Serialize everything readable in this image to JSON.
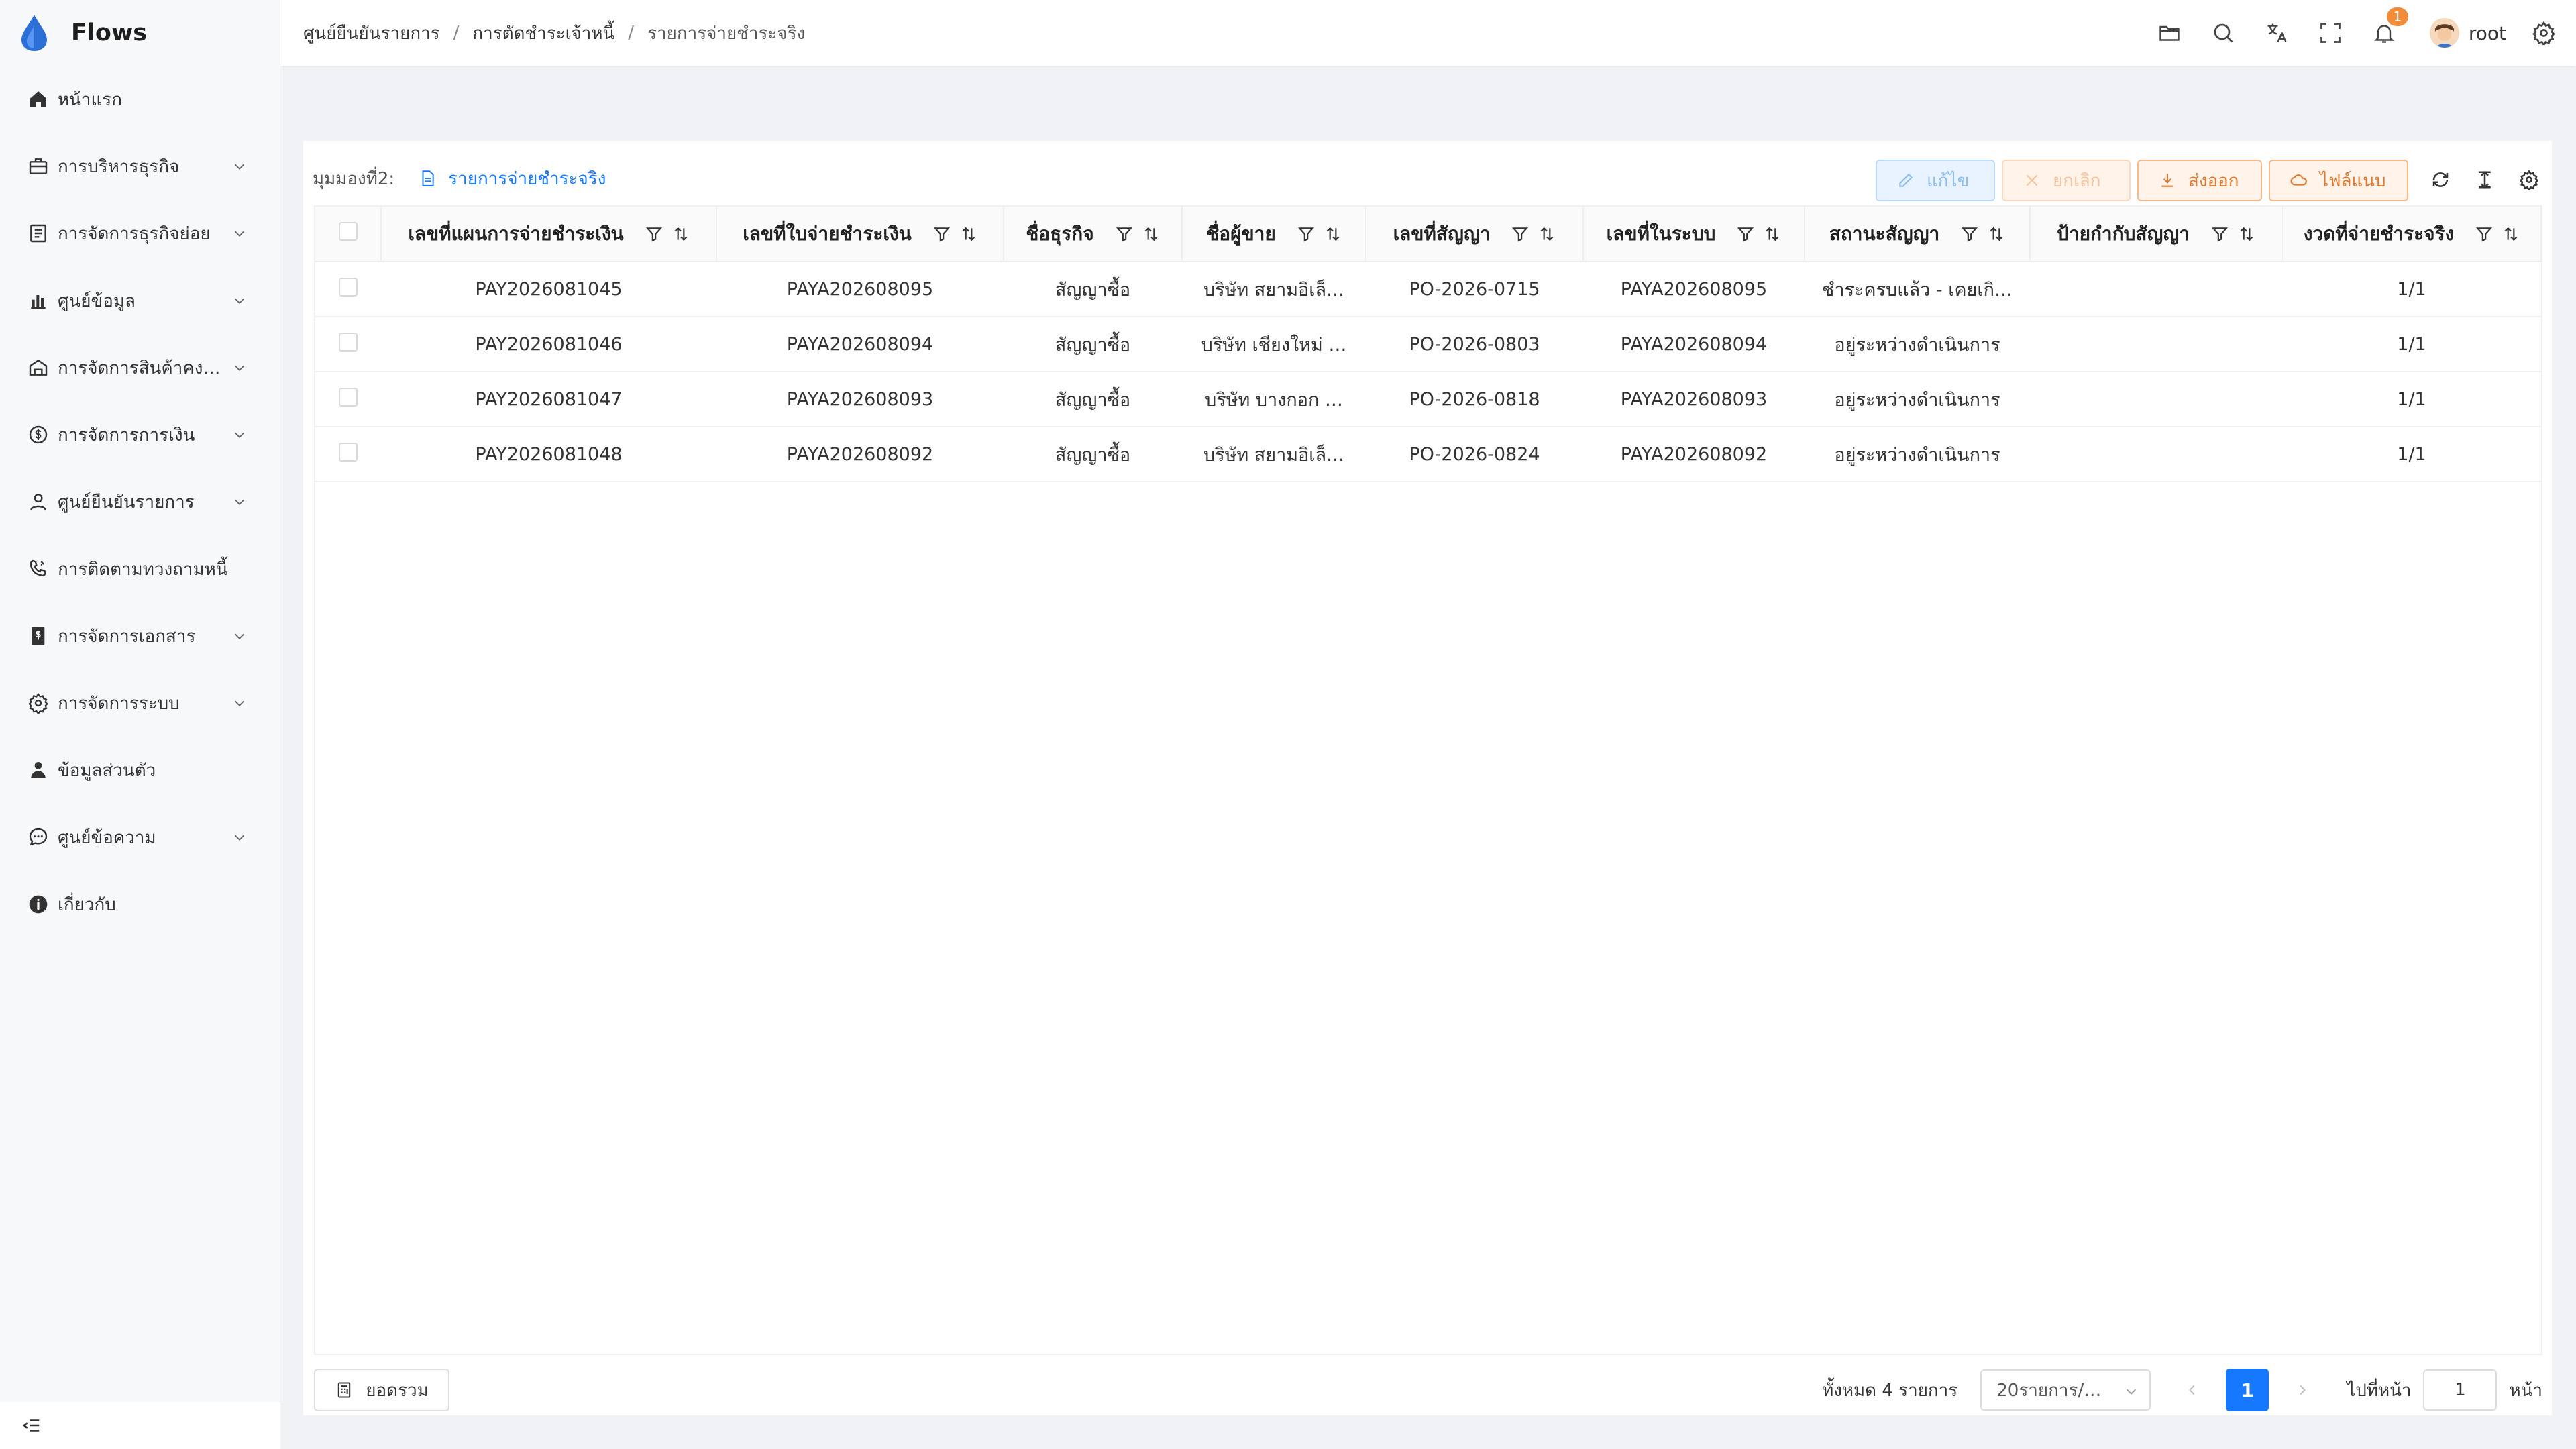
{
  "app": {
    "name": "Flows"
  },
  "sidebar": {
    "items": [
      {
        "label": "หน้าแรก",
        "icon": "home-icon",
        "expandable": false
      },
      {
        "label": "การบริหารธุรกิจ",
        "icon": "briefcase-icon",
        "expandable": true
      },
      {
        "label": "การจัดการธุรกิจย่อย",
        "icon": "list-icon",
        "expandable": true
      },
      {
        "label": "ศูนย์ข้อมูล",
        "icon": "bar-chart-icon",
        "expandable": true
      },
      {
        "label": "การจัดการสินค้าคง…",
        "icon": "warehouse-icon",
        "expandable": true
      },
      {
        "label": "การจัดการการเงิน",
        "icon": "coin-icon",
        "expandable": true
      },
      {
        "label": "ศูนย์ยืนยันรายการ",
        "icon": "user-check-icon",
        "expandable": true
      },
      {
        "label": "การติดตามทวงถามหนี้",
        "icon": "phone-icon",
        "expandable": false
      },
      {
        "label": "การจัดการเอกสาร",
        "icon": "document-dollar-icon",
        "expandable": true
      },
      {
        "label": "การจัดการระบบ",
        "icon": "gear-icon",
        "expandable": true
      },
      {
        "label": "ข้อมูลส่วนตัว",
        "icon": "person-icon",
        "expandable": false
      },
      {
        "label": "ศูนย์ข้อความ",
        "icon": "message-icon",
        "expandable": true
      },
      {
        "label": "เกี่ยวกับ",
        "icon": "info-icon",
        "expandable": false
      }
    ]
  },
  "header": {
    "breadcrumb": [
      "ศูนย์ยืนยันรายการ",
      "การตัดชำระเจ้าหนี้",
      "รายการจ่ายชำระจริง"
    ],
    "notification_count": "1",
    "username": "root"
  },
  "toolbar": {
    "view_label": "มุมมองที่2:",
    "view_name": "รายการจ่ายชำระจริง",
    "edit_label": "แก้ไข",
    "cancel_label": "ยกเลิก",
    "export_label": "ส่งออก",
    "attach_label": "ไฟล์แนบ"
  },
  "table": {
    "columns": [
      "เลขที่แผนการจ่ายชำระเงิน",
      "เลขที่ใบจ่ายชำระเงิน",
      "ชื่อธุรกิจ",
      "ชื่อผู้ขาย",
      "เลขที่สัญญา",
      "เลขที่ในระบบ",
      "สถานะสัญญา",
      "ป้ายกำกับสัญญา",
      "งวดที่จ่ายชำระจริง"
    ],
    "rows": [
      [
        "PAY2026081045",
        "PAYA202608095",
        "สัญญาซื้อ",
        "บริษัท สยามอิเล็…",
        "PO-2026-0715",
        "PAYA202608095",
        "ชำระครบแล้ว - เคยเกิ…",
        "",
        "1/1"
      ],
      [
        "PAY2026081046",
        "PAYA202608094",
        "สัญญาซื้อ",
        "บริษัท เชียงใหม่ …",
        "PO-2026-0803",
        "PAYA202608094",
        "อยู่ระหว่างดำเนินการ",
        "",
        "1/1"
      ],
      [
        "PAY2026081047",
        "PAYA202608093",
        "สัญญาซื้อ",
        "บริษัท บางกอก …",
        "PO-2026-0818",
        "PAYA202608093",
        "อยู่ระหว่างดำเนินการ",
        "",
        "1/1"
      ],
      [
        "PAY2026081048",
        "PAYA202608092",
        "สัญญาซื้อ",
        "บริษัท สยามอิเล็…",
        "PO-2026-0824",
        "PAYA202608092",
        "อยู่ระหว่างดำเนินการ",
        "",
        "1/1"
      ]
    ]
  },
  "footer": {
    "summary_label": "ยอดรวม",
    "total_text": "ทั้งหมด 4 รายการ",
    "page_size": "20รายการ/…",
    "current_page": "1",
    "goto_label": "ไปที่หน้า",
    "goto_value": "1",
    "page_suffix": "หน้า"
  },
  "colors": {
    "primary": "#1677ff",
    "warning": "#e0782e",
    "badge": "#f08c3a"
  }
}
